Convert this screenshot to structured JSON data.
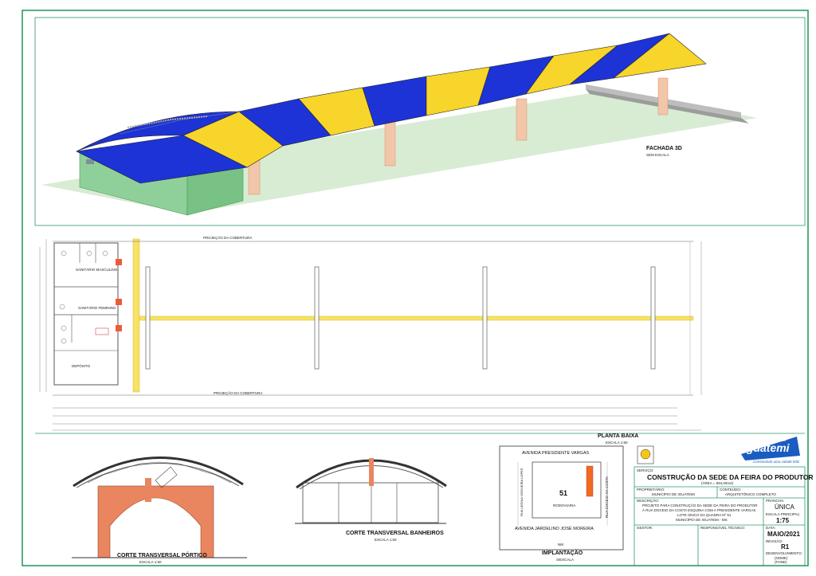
{
  "drawing": {
    "views": {
      "facade": {
        "title": "FACHADA 3D",
        "subtitle": "SEM ESCALA"
      },
      "plan": {
        "title": "PLANTA BAIXA",
        "subtitle": "ESCALA 1:50",
        "projection_top": "PROJEÇÃO DA COBERTURA",
        "projection_bottom": "PROJEÇÃO DA COBERTURA"
      },
      "section_portico": {
        "title": "CORTE TRANSVERSAL PÓRTICO",
        "subtitle": "ESCALA 1:50"
      },
      "section_banheiros": {
        "title": "CORTE TRANSVERSAL BANHEIROS",
        "subtitle": "ESCALA 1:50"
      },
      "site": {
        "title": "IMPLANTAÇÃO",
        "subtitle": "S/ESCALA",
        "street_top": "AVENIDA PRESIDENTE VARGAS",
        "street_bottom": "AVENIDA JARDELINO JOSÉ MOREIRA",
        "street_right": "RUA DOCEIO DA COSTA",
        "street_left": "RUA LEONIA NOGUEIRA LOPES",
        "lot_number": "51",
        "lot_label": "RODOVIARIA",
        "north": "NM"
      }
    },
    "rooms": {
      "masc": "SANITÁRIO MASCULINO",
      "fem": "SANITÁRIO FEMININO",
      "deposito": "DEPÓSITO"
    }
  },
  "logo": {
    "top": "PREFEITURA DE",
    "name": "Iguatemi",
    "slogan": "Construindo uma cidade feliz"
  },
  "title_block": {
    "servico_label": "SERVIÇO:",
    "servico": "CONSTRUÇÃO DA SEDE DA FEIRA DO PRODUTOR",
    "area": "(ÁREA = 594,00m2)",
    "proprietario_label": "PROPRIETÁRIO:",
    "proprietario": "MUNICÍPIO DE IGUATEMI",
    "conteudo_label": "CONTEÚDO:",
    "conteudo": "ARQUITETÔNICO COMPLETO",
    "descricao_label": "DESCRIÇÃO:",
    "descricao_1": "PROJETO PARA CONSTRUÇÃO DA SEDE DA FEIRA DO PRODUTOR",
    "descricao_2": "À RUA DOCEIO DA COSTA ESQUINA COM A PRESIDENTE VARGAS",
    "descricao_3": "LOTE ÚNICO DA QUADRA Nº 51",
    "descricao_4": "MUNICÍPIO DE IGUATEMI - MS",
    "gestor_label": "GESTOR:",
    "responsavel_label": "RESPONSÁVEL TÉCNICO:",
    "prancha_label": "PRANCHA:",
    "prancha": "ÚNICA",
    "escala_label": "ESCALA PRINCIPAL:",
    "escala": "1:75",
    "data_label": "DATA:",
    "data": "MAIO/2021",
    "revisao_label": "REVISÃO:",
    "revisao": "R1",
    "desenho_label": "DESENVOLVIMENTO:",
    "desenho_1": "(NOME)",
    "desenho_2": "(FONE)"
  },
  "colors": {
    "frame": "#2e9a66",
    "roof_blue": "#1d33d6",
    "roof_yellow": "#f7d52a",
    "ground": "#d8ecd4",
    "building": "#8fd09a",
    "brick": "#e9855f"
  }
}
